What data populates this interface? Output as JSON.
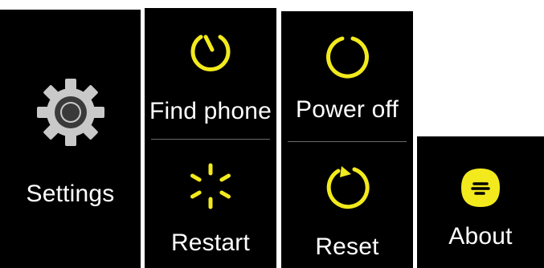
{
  "colors": {
    "background": "#000000",
    "accent_yellow": "#f2ea1c",
    "gear_gray": "#c9c9c9",
    "text": "#ffffff",
    "divider": "#6b6b6b"
  },
  "screens": {
    "settings": {
      "label": "Settings",
      "icon": "gear-icon"
    },
    "find_phone": {
      "label": "Find phone",
      "icon": "find-phone-icon"
    },
    "restart": {
      "label": "Restart",
      "icon": "restart-spinner-icon"
    },
    "power_off": {
      "label": "Power off",
      "icon": "power-off-icon"
    },
    "reset": {
      "label": "Reset",
      "icon": "reset-icon"
    },
    "about": {
      "label": "About",
      "icon": "about-icon"
    }
  }
}
